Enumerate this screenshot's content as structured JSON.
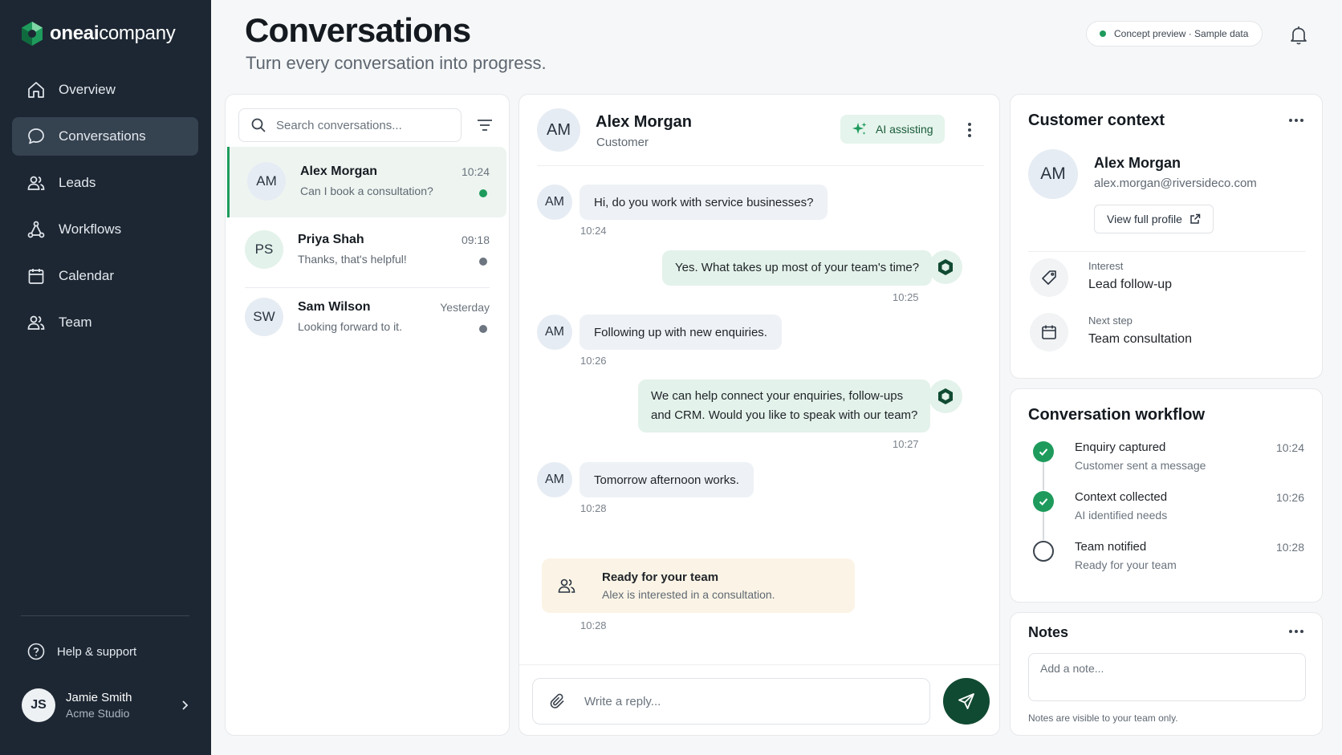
{
  "brand": {
    "name_bold": "oneai",
    "name_rest": "company"
  },
  "nav": [
    {
      "label": "Overview",
      "icon": "home-icon"
    },
    {
      "label": "Conversations",
      "icon": "chat-icon",
      "active": true
    },
    {
      "label": "Leads",
      "icon": "users-icon"
    },
    {
      "label": "Workflows",
      "icon": "workflow-icon"
    },
    {
      "label": "Calendar",
      "icon": "calendar-icon"
    },
    {
      "label": "Team",
      "icon": "team-icon"
    }
  ],
  "help_label": "Help & support",
  "user": {
    "initials": "JS",
    "name": "Jamie Smith",
    "org": "Acme Studio"
  },
  "header": {
    "title": "Conversations",
    "subtitle": "Turn every conversation into progress.",
    "badge": "Concept preview · Sample data"
  },
  "list": {
    "search_placeholder": "Search conversations...",
    "items": [
      {
        "initials": "AM",
        "name": "Alex Morgan",
        "preview": "Can I book a consultation?",
        "time": "10:24",
        "status": "green"
      },
      {
        "initials": "PS",
        "name": "Priya Shah",
        "preview": "Thanks, that's helpful!",
        "time": "09:18",
        "status": "grey"
      },
      {
        "initials": "SW",
        "name": "Sam Wilson",
        "preview": "Looking forward to it.",
        "time": "Yesterday",
        "status": "grey"
      }
    ]
  },
  "chat": {
    "initials": "AM",
    "name": "Alex Morgan",
    "role": "Customer",
    "ai_label": "AI assisting",
    "messages": [
      {
        "from": "customer",
        "initials": "AM",
        "text": "Hi, do you work with service businesses?",
        "time": "10:24"
      },
      {
        "from": "ai",
        "text": "Yes. What takes up most of your team's time?",
        "time": "10:25"
      },
      {
        "from": "customer",
        "initials": "AM",
        "text": "Following up with new enquiries.",
        "time": "10:26"
      },
      {
        "from": "ai",
        "line1": "We can help connect your enquiries, follow-ups",
        "line2": "and CRM. Would you like to speak with our team?",
        "time": "10:27"
      },
      {
        "from": "customer",
        "initials": "AM",
        "text": "Tomorrow afternoon works.",
        "time": "10:28"
      }
    ],
    "ready": {
      "title": "Ready for your team",
      "subtitle": "Alex is interested in a consultation.",
      "time": "10:28"
    },
    "reply_placeholder": "Write a reply..."
  },
  "context": {
    "title": "Customer context",
    "initials": "AM",
    "name": "Alex Morgan",
    "email": "alex.morgan@riversideco.com",
    "profile_button": "View full profile",
    "interest_label": "Interest",
    "interest_value": "Lead follow-up",
    "next_label": "Next step",
    "next_value": "Team consultation"
  },
  "workflow": {
    "title": "Conversation workflow",
    "steps": [
      {
        "title": "Enquiry captured",
        "sub": "Customer sent a message",
        "time": "10:24",
        "done": true
      },
      {
        "title": "Context collected",
        "sub": "AI identified needs",
        "time": "10:26",
        "done": true
      },
      {
        "title": "Team notified",
        "sub": "Ready for your team",
        "time": "10:28",
        "done": false
      }
    ]
  },
  "notes": {
    "title": "Notes",
    "placeholder": "Add a note...",
    "hint": "Notes are visible to your team only."
  },
  "colors": {
    "sidebar": "#1d2733",
    "accent_green": "#1e9b5c",
    "send_button": "#114a32",
    "ai_bubble": "#e3f2ea",
    "ready_card": "#fbf4e6"
  }
}
